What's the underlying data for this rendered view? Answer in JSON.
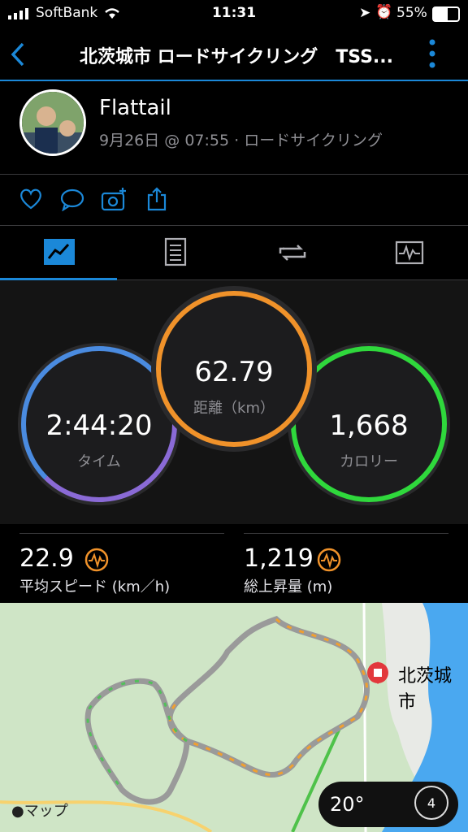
{
  "status": {
    "carrier": "SoftBank",
    "time": "11:31",
    "battery": "55%"
  },
  "header": {
    "title": "北茨城市 ロードサイクリング　TSS..."
  },
  "profile": {
    "name": "Flattail",
    "subtitle": "9月26日 @ 07:55 · ロードサイクリング"
  },
  "actions": [
    "like-icon",
    "comment-icon",
    "add-photo-icon",
    "share-icon"
  ],
  "tabs": [
    "summary-icon",
    "details-icon",
    "laps-icon",
    "charts-icon"
  ],
  "rings": {
    "time": {
      "value": "2:44:20",
      "label": "タイム"
    },
    "distance": {
      "value": "62.79",
      "label": "距離（km）"
    },
    "calories": {
      "value": "1,668",
      "label": "カロリー"
    }
  },
  "stats": [
    {
      "value": "22.9",
      "label": "平均スピード (km／h)"
    },
    {
      "value": "1,219",
      "label": "総上昇量 (m)"
    }
  ],
  "map": {
    "city": "北茨城市",
    "attribution": "マップ",
    "temperature": "20°",
    "wind": "4"
  },
  "colors": {
    "accent": "#1b88d8",
    "time_ring": "#6b78d6",
    "distance_ring": "#f0922a",
    "calorie_ring": "#2fd83c"
  }
}
